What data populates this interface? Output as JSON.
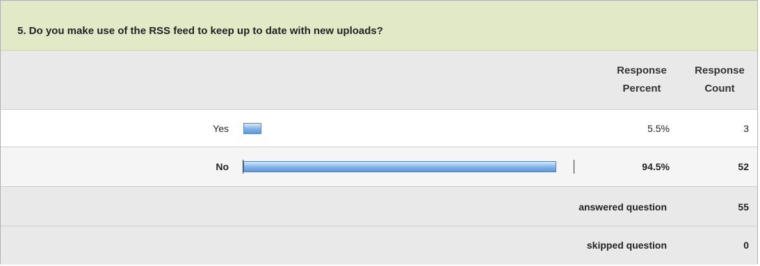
{
  "question": {
    "text": "5. Do you make use of the RSS feed to keep up to date with new uploads?"
  },
  "columns": {
    "percent_line1": "Response",
    "percent_line2": "Percent",
    "count_line1": "Response",
    "count_line2": "Count"
  },
  "chart_data": {
    "type": "bar",
    "orientation": "horizontal",
    "categories": [
      "Yes",
      "No"
    ],
    "values": [
      5.5,
      94.5
    ],
    "percent_labels": [
      "5.5%",
      "94.5%"
    ],
    "counts": [
      "3",
      "52"
    ],
    "xlim": [
      0,
      100
    ]
  },
  "rows": [
    {
      "label": "Yes",
      "percent": "5.5%",
      "count": "3"
    },
    {
      "label": "No",
      "percent": "94.5%",
      "count": "52"
    }
  ],
  "footer": {
    "answered_label": "answered question",
    "answered_value": "55",
    "skipped_label": "skipped question",
    "skipped_value": "0"
  },
  "colors": {
    "header_bg": "#e2e9c7",
    "bar": "#7fb1e8"
  }
}
